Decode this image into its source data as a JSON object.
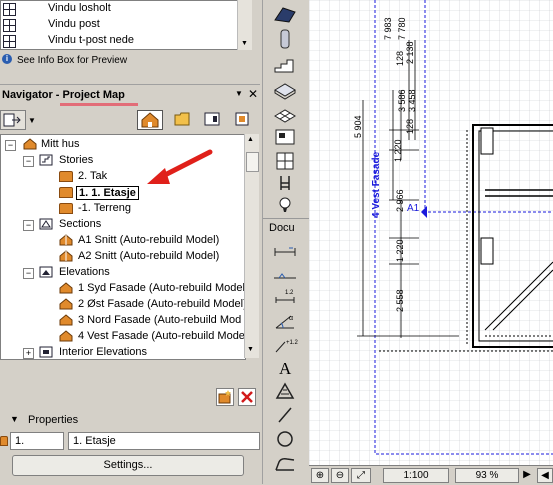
{
  "object_list": {
    "items": [
      {
        "label": "Vindu losholt"
      },
      {
        "label": "Vindu post"
      },
      {
        "label": "Vindu t-post nede"
      }
    ]
  },
  "info_box": {
    "label": "See Info Box for Preview"
  },
  "navigator": {
    "title": "Navigator - Project Map",
    "tree": {
      "root": "Mitt hus",
      "stories_label": "Stories",
      "stories": [
        "2. Tak",
        "1. 1. Etasje",
        "-1. Terreng"
      ],
      "sections_label": "Sections",
      "sections": [
        "A1 Snitt (Auto-rebuild Model)",
        "A2 Snitt (Auto-rebuild Model)"
      ],
      "elevations_label": "Elevations",
      "elevations": [
        "1 Syd Fasade (Auto-rebuild Model",
        "2 Øst Fasade (Auto-rebuild Model)",
        "3 Nord Fasade (Auto-rebuild Mod",
        "4 Vest Fasade (Auto-rebuild Mode"
      ],
      "interior_label": "Interior Elevations"
    }
  },
  "properties": {
    "label": "Properties",
    "id_value": "1.",
    "name_value": "1. Etasje",
    "settings_button": "Settings..."
  },
  "toolbox": {
    "docu_label": "Docu"
  },
  "drawing": {
    "dims_vertical": [
      "7 983",
      "7 780",
      "128",
      "2 138",
      "3 586",
      "3 458",
      "128",
      "5 904",
      "1 220",
      "2 966",
      "1 220",
      "2 558"
    ],
    "elevation_label": "4 Vest Fasade",
    "section_label": "A1"
  },
  "status_bar": {
    "scale": "1:100",
    "zoom": "93 %"
  },
  "colors": {
    "accent_underline": "#e26d78",
    "arrow": "#e0201a",
    "elevation_blue": "#1a1adc",
    "folder": "#e08a2c"
  }
}
